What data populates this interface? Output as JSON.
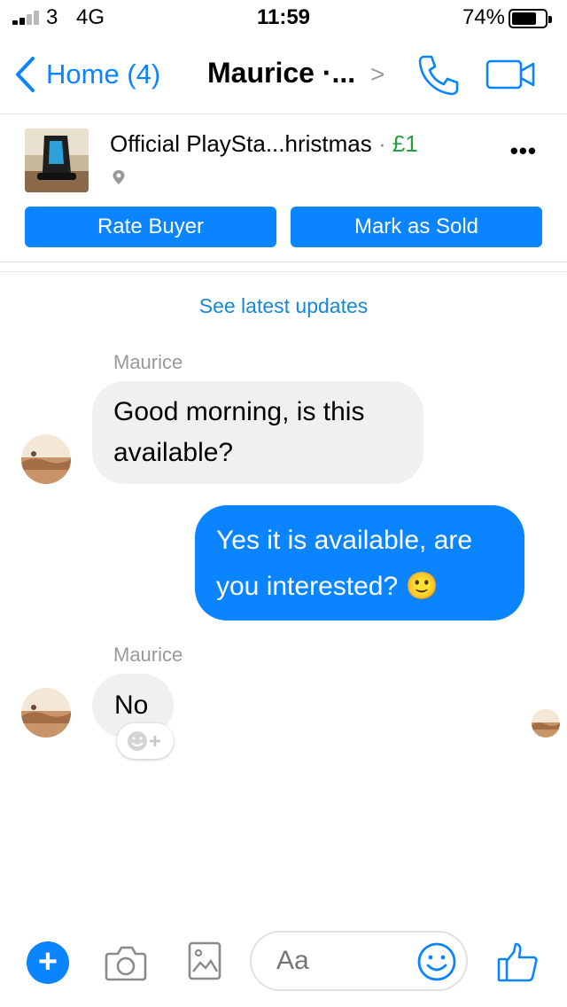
{
  "status_bar": {
    "carrier": "3",
    "network": "4G",
    "time": "11:59",
    "battery": "74%",
    "battery_level": 0.74
  },
  "nav": {
    "back_label": "Home (4)",
    "title": "Maurice ·...",
    "title_chevron": ">"
  },
  "listing": {
    "title": "Official PlaySta...hristmas",
    "separator": " · ",
    "price": "£1",
    "more_label": "•••",
    "rate_buyer_label": "Rate Buyer",
    "mark_sold_label": "Mark as Sold"
  },
  "conversation": {
    "see_updates_label": "See latest updates",
    "messages": [
      {
        "sender": "Maurice",
        "text": "Good morning, is this available?"
      },
      {
        "sender": "me",
        "text": "Yes it is available, are you interested? 🙂"
      },
      {
        "sender": "Maurice",
        "text": "No"
      }
    ]
  },
  "composer": {
    "placeholder": "Aa"
  },
  "colors": {
    "accent": "#0a84ff",
    "price": "#27a044",
    "link": "#1787d6",
    "incoming_bubble": "#f0f0f0"
  },
  "icons": [
    "signal-icon",
    "battery-icon",
    "back-chevron-icon",
    "phone-icon",
    "video-camera-icon",
    "location-pin-icon",
    "more-icon",
    "add-reaction-icon",
    "plus-icon",
    "camera-icon",
    "gallery-icon",
    "emoji-icon",
    "thumbs-up-icon"
  ]
}
